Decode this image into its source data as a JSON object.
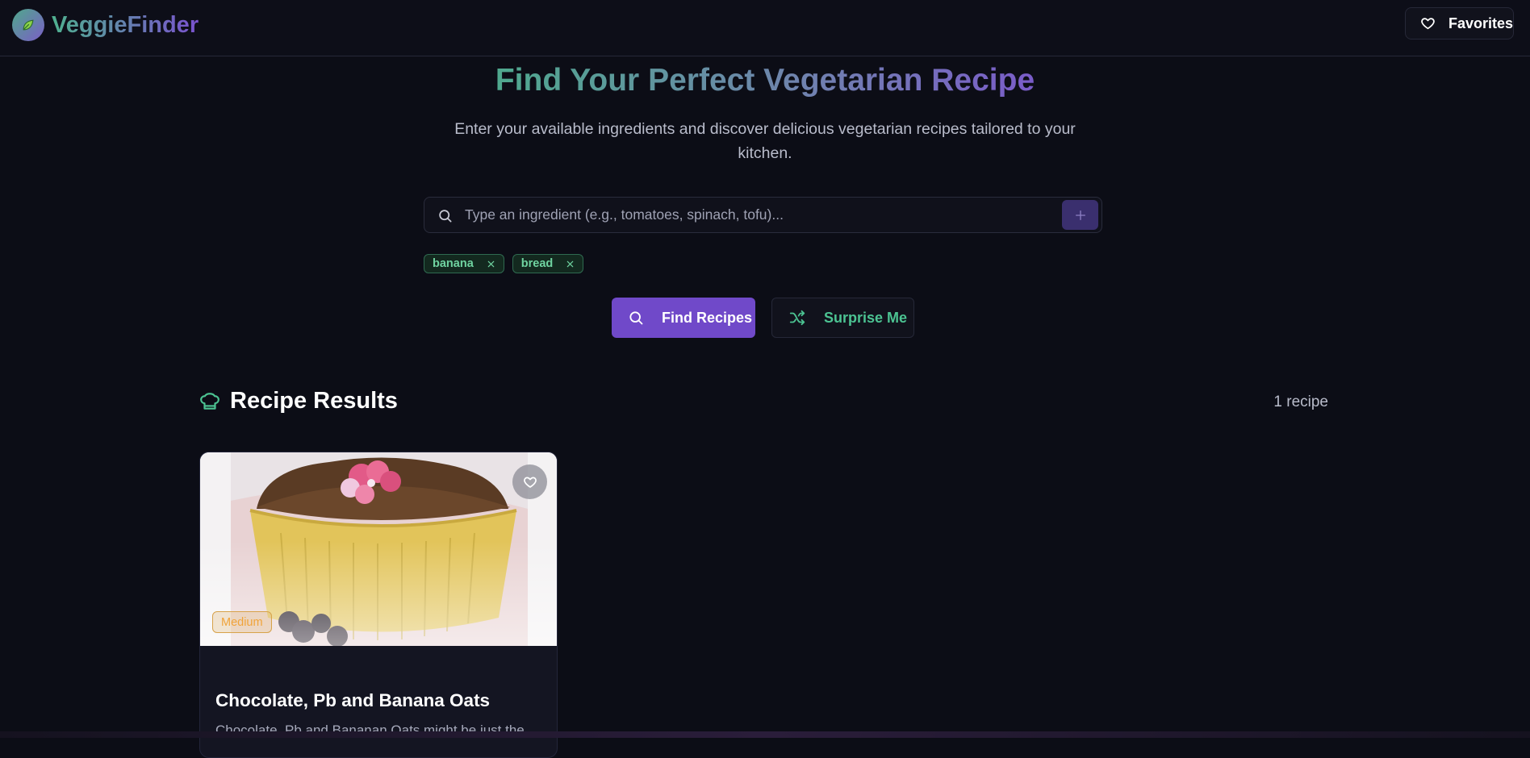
{
  "app": {
    "name": "VeggieFinder",
    "favorites_label": "Favorites"
  },
  "hero": {
    "title": "Find Your Perfect Vegetarian Recipe",
    "subtitle": "Enter your available ingredients and discover delicious vegetarian recipes tailored to your kitchen."
  },
  "search": {
    "placeholder": "Type an ingredient (e.g., tomatoes, spinach, tofu)...",
    "value": "",
    "add_icon": "plus-icon"
  },
  "ingredients": [
    {
      "label": "banana"
    },
    {
      "label": "bread"
    }
  ],
  "actions": {
    "find_label": "Find Recipes",
    "surprise_label": "Surprise Me"
  },
  "results": {
    "title": "Recipe Results",
    "count": "1 recipe",
    "icon": "chef-hat-icon"
  },
  "recipes": [
    {
      "title": "Chocolate, Pb and Banana Oats",
      "description": "Chocolate, Pb and Bananan Oats might be just the",
      "difficulty": "Medium",
      "favorited": false
    }
  ],
  "colors": {
    "background": "#0c0d16",
    "accent_purple": "#7049c9",
    "accent_green": "#4cc392",
    "difficulty_orange": "#f0a43a"
  }
}
